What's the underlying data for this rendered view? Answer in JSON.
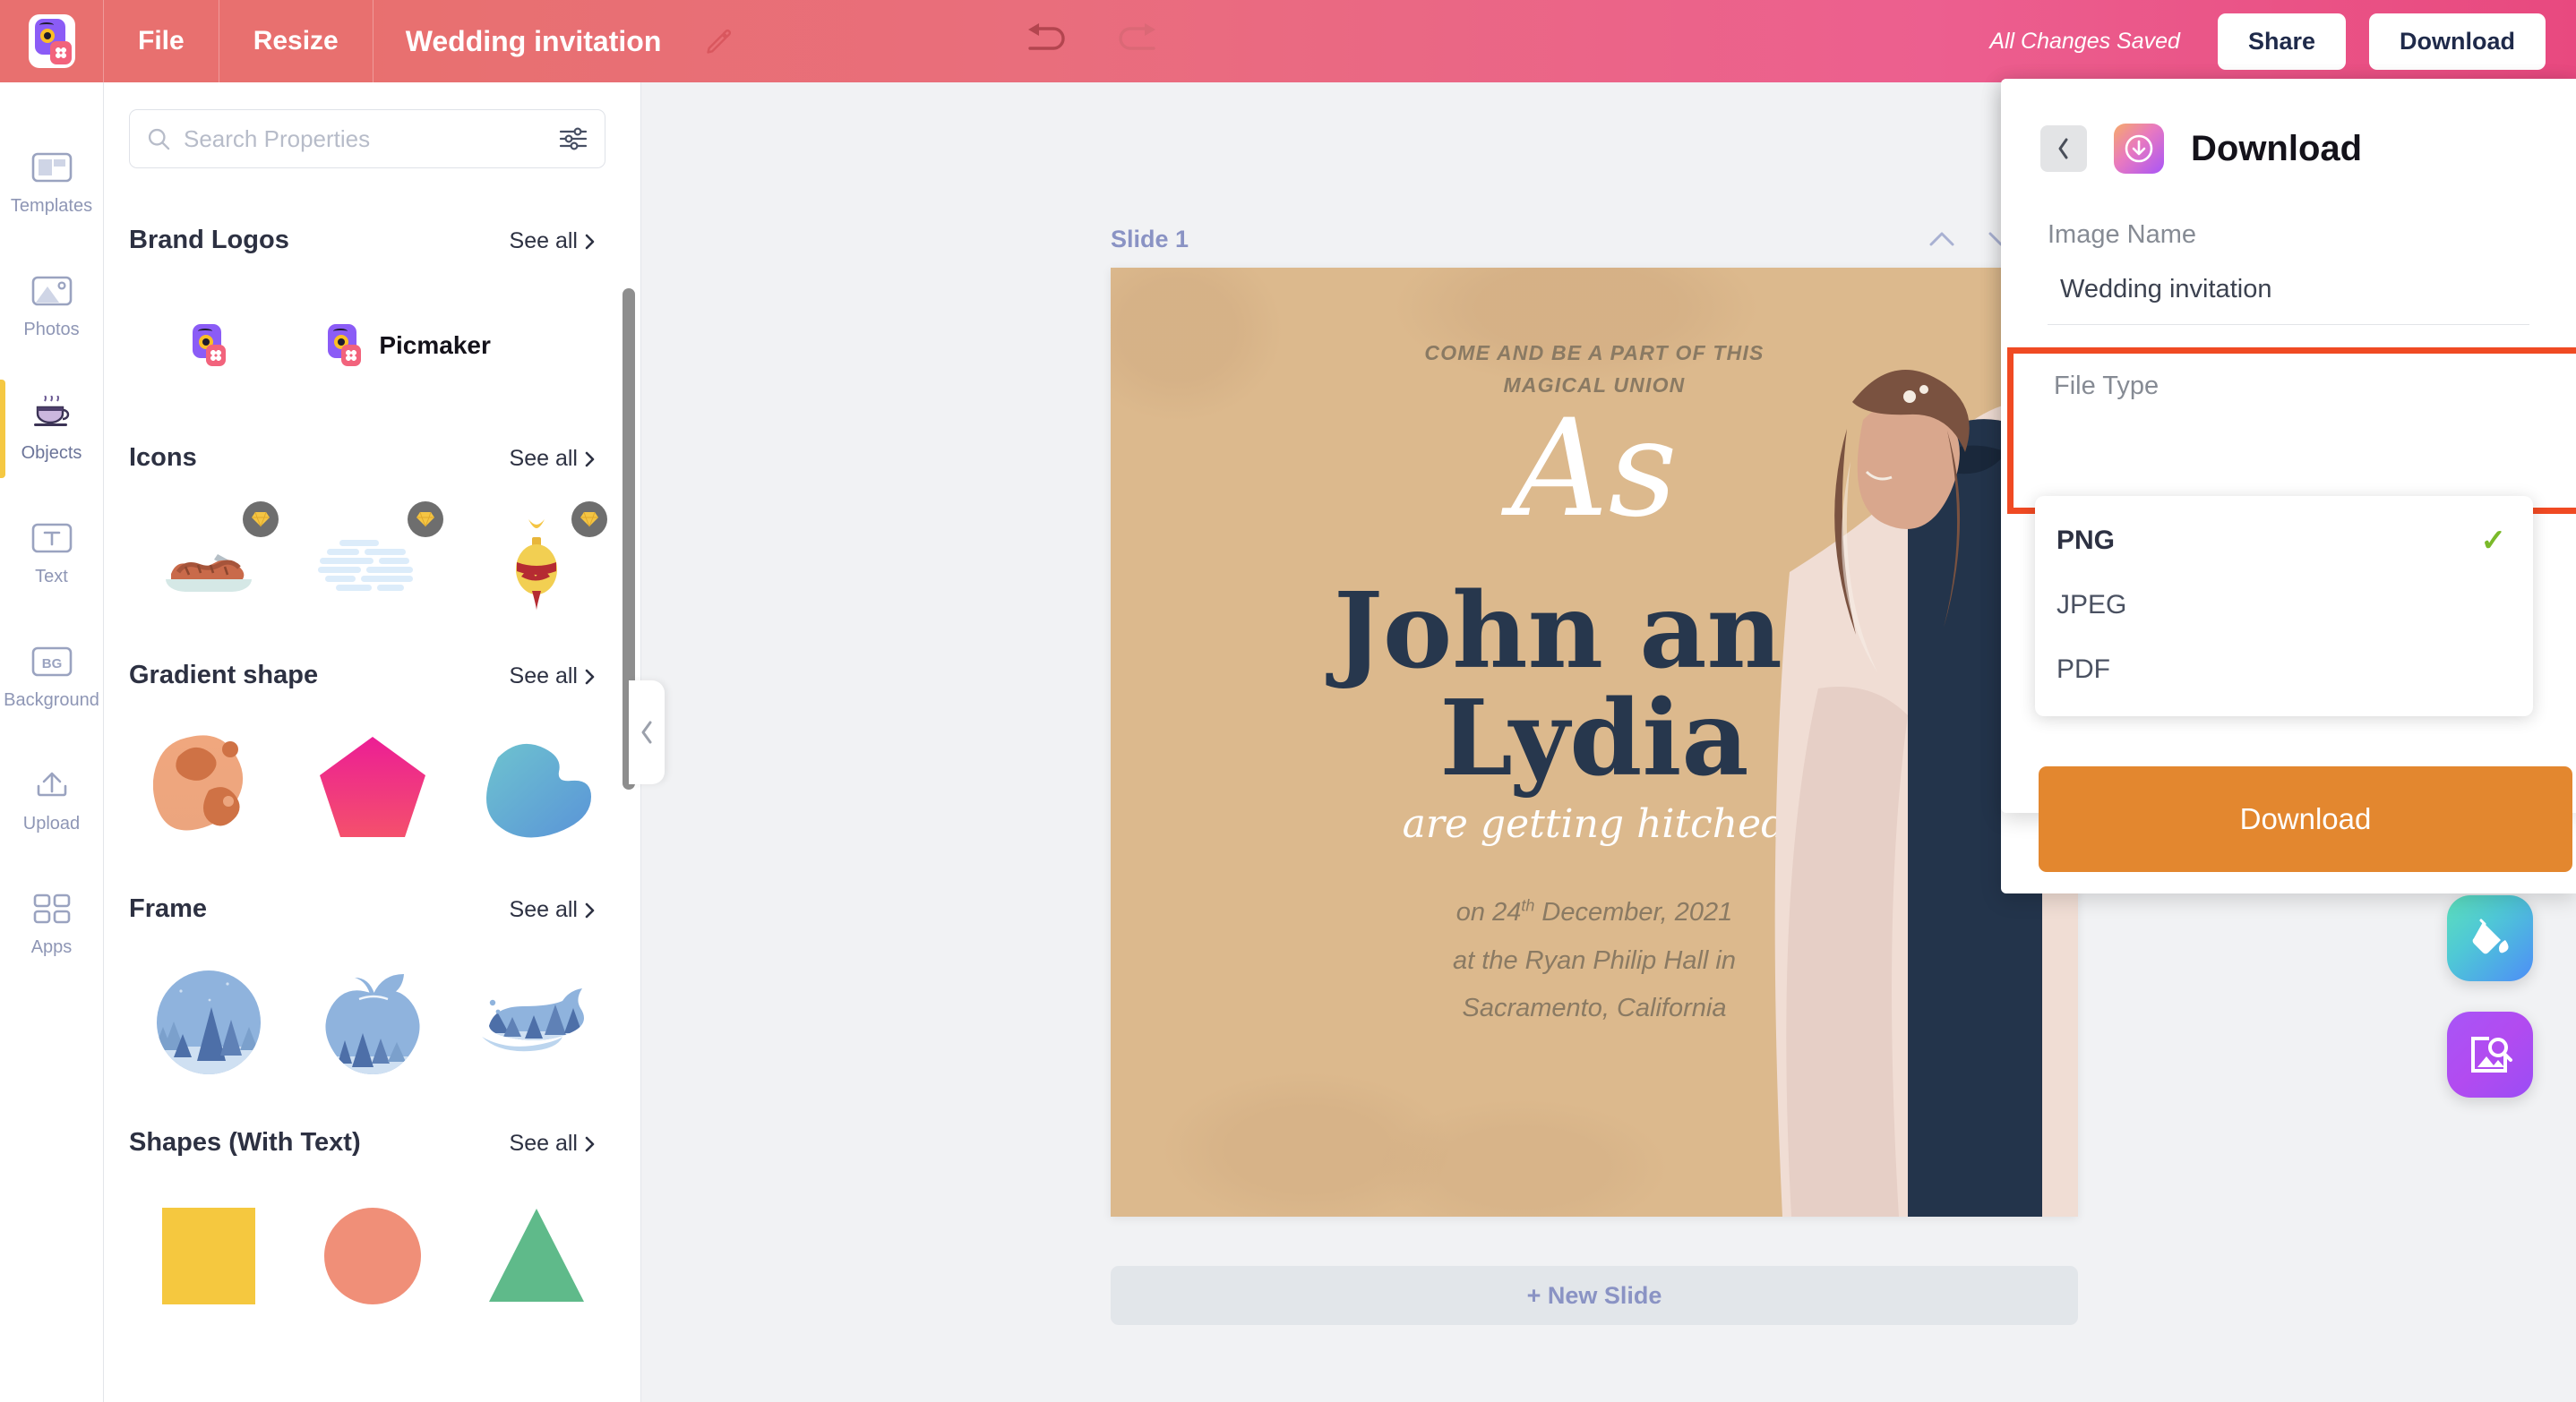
{
  "topbar": {
    "logo_name": "picmaker-logo",
    "menu": [
      {
        "label": "File",
        "name": "menu-file"
      },
      {
        "label": "Resize",
        "name": "menu-resize"
      }
    ],
    "doc_title": "Wedding invitation",
    "edit_icon": "pencil-icon",
    "undo_icon": "undo-icon",
    "redo_icon": "redo-icon",
    "saved_status": "All Changes Saved",
    "share_label": "Share",
    "download_label": "Download",
    "bg_start": "#e8706f",
    "bg_end": "#e8497f"
  },
  "rail": {
    "items": [
      {
        "label": "Templates",
        "icon": "templates-icon",
        "active": false
      },
      {
        "label": "Photos",
        "icon": "photos-icon",
        "active": false
      },
      {
        "label": "Objects",
        "icon": "objects-cup-icon",
        "active": true
      },
      {
        "label": "Text",
        "icon": "text-icon",
        "active": false
      },
      {
        "label": "Background",
        "icon": "background-icon",
        "active": false
      },
      {
        "label": "Upload",
        "icon": "upload-icon",
        "active": false
      },
      {
        "label": "Apps",
        "icon": "apps-grid-icon",
        "active": false
      }
    ],
    "active_accent": "#f5c842"
  },
  "panel": {
    "search": {
      "placeholder": "Search Properties",
      "value": "",
      "search_icon": "search-icon",
      "filter_icon": "filter-sliders-icon"
    },
    "see_all_label": "See all",
    "sections": [
      {
        "title": "Brand Logos",
        "name": "section-brand-logos",
        "items": [
          {
            "name": "brand-logo-mark",
            "type": "logo-mark",
            "premium": false
          },
          {
            "name": "brand-logo-wordmark",
            "type": "logo-wordmark",
            "label": "Picmaker",
            "premium": false
          }
        ]
      },
      {
        "title": "Icons",
        "name": "section-icons",
        "items": [
          {
            "name": "icon-sausages-platter",
            "type": "sausages",
            "premium": true
          },
          {
            "name": "icon-cloud",
            "type": "cloud",
            "premium": true
          },
          {
            "name": "icon-ornament",
            "type": "ornament",
            "premium": true
          }
        ]
      },
      {
        "title": "Gradient shape",
        "name": "section-gradient-shape",
        "items": [
          {
            "name": "gradient-blob-orange",
            "type": "blob-orange",
            "premium": false
          },
          {
            "name": "gradient-pentagon-pink",
            "type": "pentagon-pink",
            "premium": false
          },
          {
            "name": "gradient-blob-blue",
            "type": "blob-blue",
            "premium": false
          }
        ]
      },
      {
        "title": "Frame",
        "name": "section-frame",
        "items": [
          {
            "name": "frame-circle-forest",
            "type": "frame-circle",
            "premium": false
          },
          {
            "name": "frame-apple-forest",
            "type": "frame-apple",
            "premium": false
          },
          {
            "name": "frame-whale-forest",
            "type": "frame-whale",
            "premium": false
          }
        ]
      },
      {
        "title": "Shapes (With Text)",
        "name": "section-shapes-with-text",
        "items": [
          {
            "name": "shape-square-yellow",
            "type": "square",
            "color": "#f5c83f",
            "premium": false
          },
          {
            "name": "shape-circle-salmon",
            "type": "circle",
            "color": "#f08f78",
            "premium": false
          },
          {
            "name": "shape-triangle-green",
            "type": "triangle",
            "color": "#5fba8a",
            "premium": false
          }
        ]
      }
    ],
    "collapse_icon": "chevron-left-icon"
  },
  "canvas": {
    "slide_label": "Slide 1",
    "move_up_icon": "chevron-up-icon",
    "move_down_icon": "chevron-down-icon",
    "duplicate_icon": "duplicate-slide-icon",
    "new_slide_label": "+ New Slide",
    "background_color": "#dcb98d",
    "invitation": {
      "eyebrow_line1": "COME AND BE A PART OF THIS",
      "eyebrow_line2": "MAGICAL UNION",
      "monogram": "As",
      "name_line1": "John and",
      "name_line2": "Lydia",
      "tagline": "are getting hitched",
      "date_prefix": "on 24",
      "date_suffix": "th",
      "date_rest": " December, 2021",
      "venue": "at the Ryan Philip Hall in",
      "location": "Sacramento, California",
      "text_color": "#27374d",
      "accent_text_color": "#8a7a63"
    }
  },
  "fabs": [
    {
      "name": "background-fill-button",
      "icon": "paint-bucket-icon"
    },
    {
      "name": "image-search-button",
      "icon": "image-search-icon"
    }
  ],
  "download_panel": {
    "back_icon": "chevron-left-icon",
    "logo_icon": "download-circle-icon",
    "title": "Download",
    "image_name_label": "Image Name",
    "image_name_value": "Wedding invitation",
    "file_type_label": "File Type",
    "file_type_options": [
      {
        "label": "PNG",
        "selected": true
      },
      {
        "label": "JPEG",
        "selected": false
      },
      {
        "label": "PDF",
        "selected": false
      }
    ],
    "check_icon": "check-icon",
    "check_color": "#7ab929",
    "download_button_label": "Download",
    "download_button_color": "#e3872f",
    "highlight_color": "#f04a23"
  }
}
